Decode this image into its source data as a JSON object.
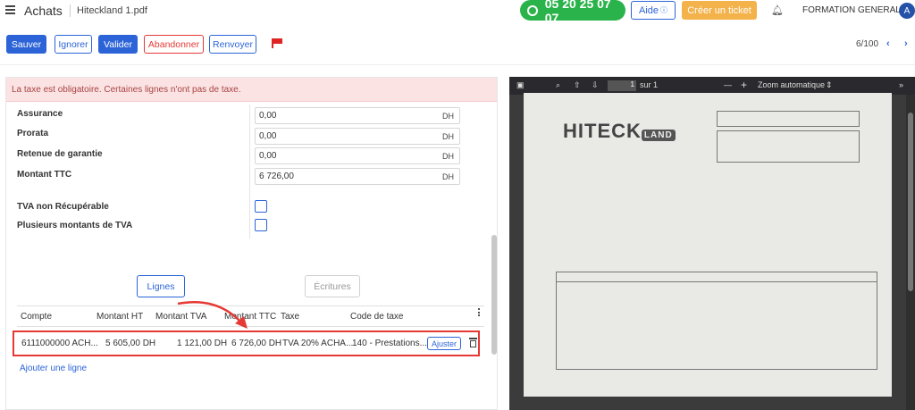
{
  "topbar": {
    "app_title": "Achats",
    "file_name": "Hiteckland 1.pdf",
    "phone": "05 20 25 07 07",
    "help_label": "Aide",
    "help_icon": "question-circle-icon",
    "ticket_label": "Créer un ticket",
    "bell_icon": "bell-icon",
    "organization": "FORMATION GENERALE",
    "avatar_letter": "A"
  },
  "toolbar": {
    "save": "Sauver",
    "ignore": "Ignorer",
    "validate": "Valider",
    "abandon": "Abandonner",
    "resend": "Renvoyer",
    "pager": "6/100"
  },
  "alert": "La taxe est obligatoire. Certaines lignes n'ont pas de taxe.",
  "fields": [
    {
      "label": "Assurance",
      "value": "0,00",
      "unit": "DH"
    },
    {
      "label": "Prorata",
      "value": "0,00",
      "unit": "DH"
    },
    {
      "label": "Retenue de garantie",
      "value": "0,00",
      "unit": "DH"
    },
    {
      "label": "Montant TTC",
      "value": "6 726,00",
      "unit": "DH"
    }
  ],
  "checkboxes": [
    {
      "label": "TVA non Récupérable",
      "checked": false
    },
    {
      "label": "Plusieurs montants de TVA",
      "checked": false
    }
  ],
  "tabs": {
    "lines": "Lignes",
    "entries": "Écritures"
  },
  "table": {
    "headers": [
      "Compte",
      "Montant HT",
      "Montant TVA",
      "Montant TTC",
      "Taxe",
      "Code de taxe"
    ],
    "row": {
      "account": "6111000000 ACH...",
      "ht": "5 605,00 DH",
      "tva": "1 121,00 DH",
      "ttc": "6 726,00 DH",
      "tax": "TVA 20% ACHA...",
      "tax_code": "140 - Prestations...",
      "adjust": "Ajuster"
    },
    "add_line": "Ajouter une ligne"
  },
  "pdf": {
    "page": "1",
    "of": "sur 1",
    "zoom": "Zoom automatique",
    "minus": "—",
    "plus": "+"
  },
  "colors": {
    "primary": "#2c64d8",
    "danger": "#e53935",
    "success": "#2ab34a",
    "warning": "#f3b24a"
  }
}
